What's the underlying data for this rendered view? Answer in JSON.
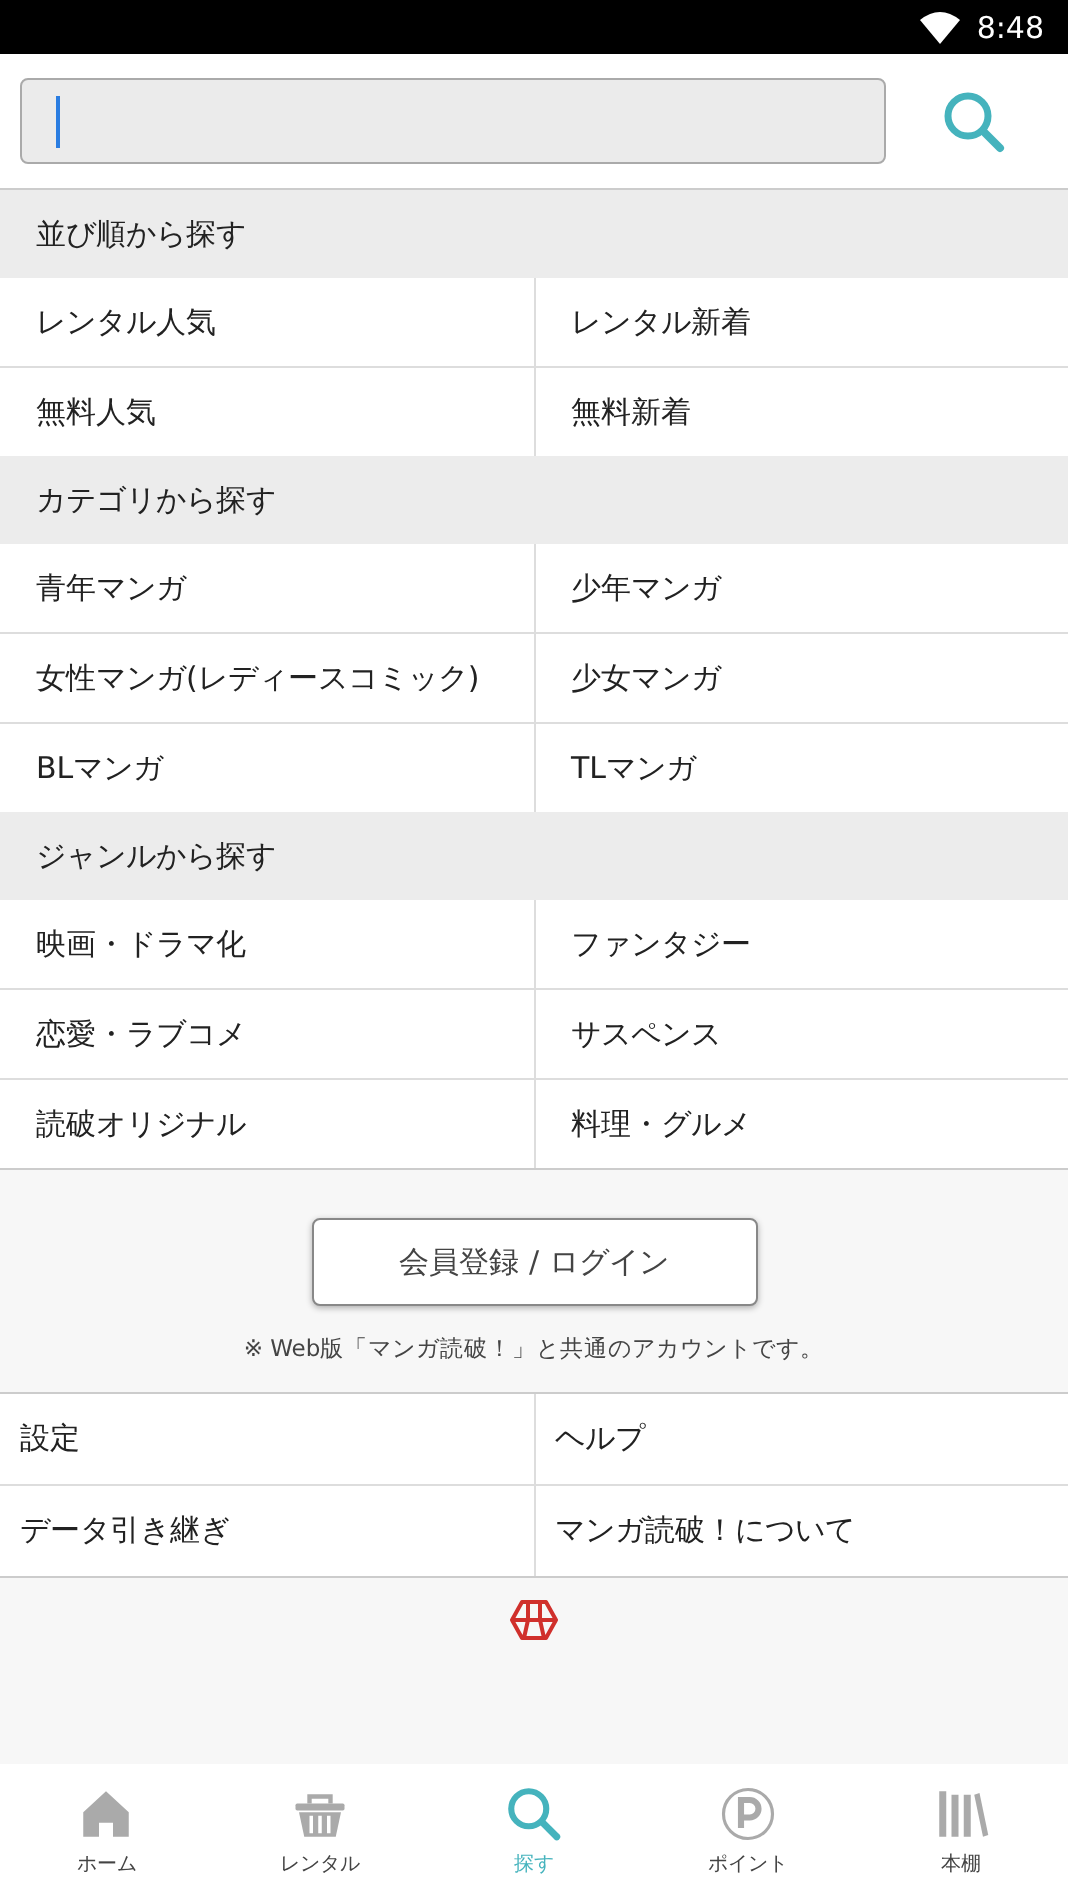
{
  "status_bar": {
    "time": "8:48"
  },
  "search": {
    "focused": true
  },
  "sections": [
    {
      "title": "並び順から探す",
      "items": [
        "レンタル人気",
        "レンタル新着",
        "無料人気",
        "無料新着"
      ]
    },
    {
      "title": "カテゴリから探す",
      "items": [
        "青年マンガ",
        "少年マンガ",
        "女性マンガ(レディースコミック)",
        "少女マンガ",
        "BLマンガ",
        "TLマンガ"
      ]
    },
    {
      "title": "ジャンルから探す",
      "items": [
        "映画・ドラマ化",
        "ファンタジー",
        "恋愛・ラブコメ",
        "サスペンス",
        "読破オリジナル",
        "料理・グルメ"
      ]
    }
  ],
  "login_button": "会員登録 / ログイン",
  "note": "※ Web版「マンガ読破！」と共通のアカウントです。",
  "menu": [
    "設定",
    "ヘルプ",
    "データ引き継ぎ",
    "マンガ読破！について"
  ],
  "tabs": [
    {
      "label": "ホーム",
      "kind": "home",
      "selected": false
    },
    {
      "label": "レンタル",
      "kind": "basket",
      "selected": false
    },
    {
      "label": "探す",
      "kind": "search",
      "selected": true
    },
    {
      "label": "ポイント",
      "kind": "point",
      "selected": false
    },
    {
      "label": "本棚",
      "kind": "shelf",
      "selected": false
    }
  ]
}
